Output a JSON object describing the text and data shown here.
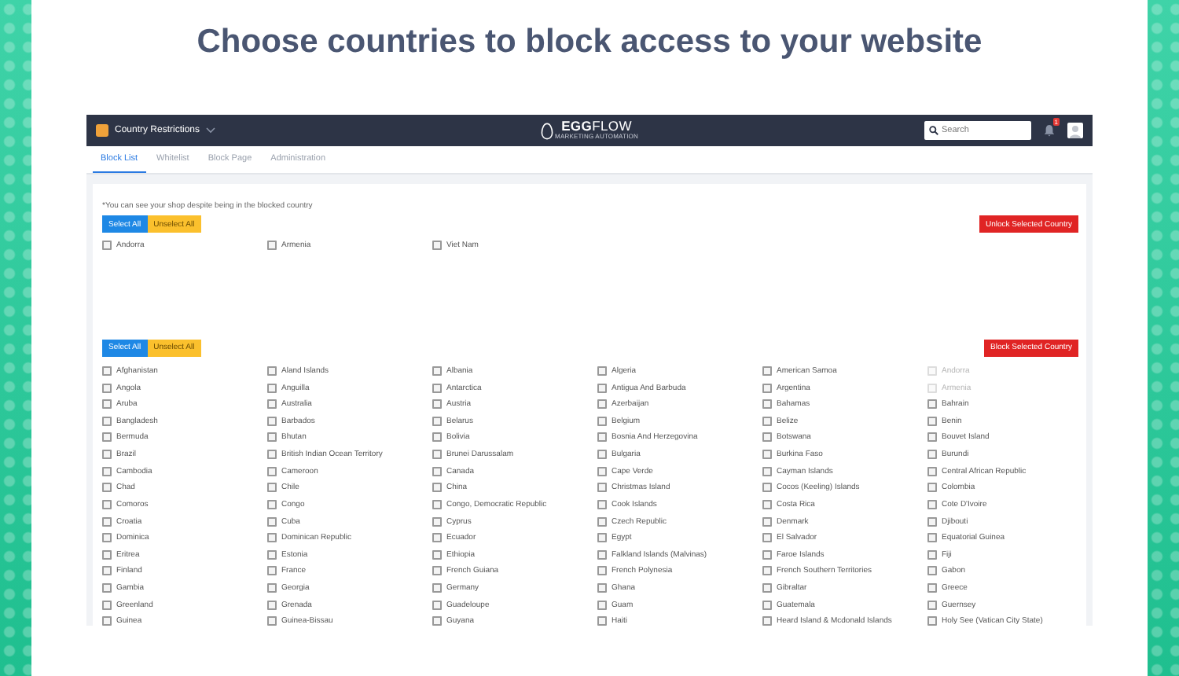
{
  "headline": "Choose countries to block access to your website",
  "app": {
    "title": "Country Restrictions",
    "logo": {
      "strong": "EGG",
      "light": "FLOW",
      "tagline": "MARKETING AUTOMATION"
    },
    "search": {
      "placeholder": "Search"
    },
    "notification_count": "1"
  },
  "tabs": [
    {
      "label": "Block List",
      "selected": true
    },
    {
      "label": "Whitelist",
      "selected": false
    },
    {
      "label": "Block Page",
      "selected": false
    },
    {
      "label": "Administration",
      "selected": false
    }
  ],
  "blocked": {
    "note": "*You can see your shop despite being in the blocked country",
    "select_all": "Select All",
    "unselect_all": "Unselect All",
    "action": "Unlock Selected Country",
    "countries": [
      {
        "name": "Andorra",
        "checked": false
      },
      {
        "name": "Armenia",
        "checked": false
      },
      {
        "name": "Viet Nam",
        "checked": false
      }
    ]
  },
  "available": {
    "select_all": "Select All",
    "unselect_all": "Unselect All",
    "action": "Block Selected Country",
    "countries": [
      {
        "name": "Afghanistan",
        "checked": false,
        "disabled": false
      },
      {
        "name": "Aland Islands",
        "checked": false,
        "disabled": false
      },
      {
        "name": "Albania",
        "checked": false,
        "disabled": false
      },
      {
        "name": "Algeria",
        "checked": false,
        "disabled": false
      },
      {
        "name": "American Samoa",
        "checked": false,
        "disabled": false
      },
      {
        "name": "Andorra",
        "checked": false,
        "disabled": true
      },
      {
        "name": "Angola",
        "checked": false,
        "disabled": false
      },
      {
        "name": "Anguilla",
        "checked": false,
        "disabled": false
      },
      {
        "name": "Antarctica",
        "checked": false,
        "disabled": false
      },
      {
        "name": "Antigua And Barbuda",
        "checked": false,
        "disabled": false
      },
      {
        "name": "Argentina",
        "checked": false,
        "disabled": false
      },
      {
        "name": "Armenia",
        "checked": false,
        "disabled": true
      },
      {
        "name": "Aruba",
        "checked": false,
        "disabled": false
      },
      {
        "name": "Australia",
        "checked": false,
        "disabled": false
      },
      {
        "name": "Austria",
        "checked": false,
        "disabled": false
      },
      {
        "name": "Azerbaijan",
        "checked": false,
        "disabled": false
      },
      {
        "name": "Bahamas",
        "checked": false,
        "disabled": false
      },
      {
        "name": "Bahrain",
        "checked": false,
        "disabled": false
      },
      {
        "name": "Bangladesh",
        "checked": false,
        "disabled": false
      },
      {
        "name": "Barbados",
        "checked": false,
        "disabled": false
      },
      {
        "name": "Belarus",
        "checked": false,
        "disabled": false
      },
      {
        "name": "Belgium",
        "checked": false,
        "disabled": false
      },
      {
        "name": "Belize",
        "checked": false,
        "disabled": false
      },
      {
        "name": "Benin",
        "checked": false,
        "disabled": false
      },
      {
        "name": "Bermuda",
        "checked": false,
        "disabled": false
      },
      {
        "name": "Bhutan",
        "checked": false,
        "disabled": false
      },
      {
        "name": "Bolivia",
        "checked": false,
        "disabled": false
      },
      {
        "name": "Bosnia And Herzegovina",
        "checked": false,
        "disabled": false
      },
      {
        "name": "Botswana",
        "checked": false,
        "disabled": false
      },
      {
        "name": "Bouvet Island",
        "checked": false,
        "disabled": false
      },
      {
        "name": "Brazil",
        "checked": false,
        "disabled": false
      },
      {
        "name": "British Indian Ocean Territory",
        "checked": false,
        "disabled": false
      },
      {
        "name": "Brunei Darussalam",
        "checked": false,
        "disabled": false
      },
      {
        "name": "Bulgaria",
        "checked": false,
        "disabled": false
      },
      {
        "name": "Burkina Faso",
        "checked": false,
        "disabled": false
      },
      {
        "name": "Burundi",
        "checked": false,
        "disabled": false
      },
      {
        "name": "Cambodia",
        "checked": false,
        "disabled": false
      },
      {
        "name": "Cameroon",
        "checked": false,
        "disabled": false
      },
      {
        "name": "Canada",
        "checked": false,
        "disabled": false
      },
      {
        "name": "Cape Verde",
        "checked": false,
        "disabled": false
      },
      {
        "name": "Cayman Islands",
        "checked": false,
        "disabled": false
      },
      {
        "name": "Central African Republic",
        "checked": false,
        "disabled": false
      },
      {
        "name": "Chad",
        "checked": false,
        "disabled": false
      },
      {
        "name": "Chile",
        "checked": false,
        "disabled": false
      },
      {
        "name": "China",
        "checked": false,
        "disabled": false
      },
      {
        "name": "Christmas Island",
        "checked": false,
        "disabled": false
      },
      {
        "name": "Cocos (Keeling) Islands",
        "checked": false,
        "disabled": false
      },
      {
        "name": "Colombia",
        "checked": false,
        "disabled": false
      },
      {
        "name": "Comoros",
        "checked": false,
        "disabled": false
      },
      {
        "name": "Congo",
        "checked": false,
        "disabled": false
      },
      {
        "name": "Congo, Democratic Republic",
        "checked": false,
        "disabled": false
      },
      {
        "name": "Cook Islands",
        "checked": false,
        "disabled": false
      },
      {
        "name": "Costa Rica",
        "checked": false,
        "disabled": false
      },
      {
        "name": "Cote D'Ivoire",
        "checked": false,
        "disabled": false
      },
      {
        "name": "Croatia",
        "checked": false,
        "disabled": false
      },
      {
        "name": "Cuba",
        "checked": false,
        "disabled": false
      },
      {
        "name": "Cyprus",
        "checked": false,
        "disabled": false
      },
      {
        "name": "Czech Republic",
        "checked": false,
        "disabled": false
      },
      {
        "name": "Denmark",
        "checked": false,
        "disabled": false
      },
      {
        "name": "Djibouti",
        "checked": false,
        "disabled": false
      },
      {
        "name": "Dominica",
        "checked": false,
        "disabled": false
      },
      {
        "name": "Dominican Republic",
        "checked": false,
        "disabled": false
      },
      {
        "name": "Ecuador",
        "checked": false,
        "disabled": false
      },
      {
        "name": "Egypt",
        "checked": false,
        "disabled": false
      },
      {
        "name": "El Salvador",
        "checked": false,
        "disabled": false
      },
      {
        "name": "Equatorial Guinea",
        "checked": false,
        "disabled": false
      },
      {
        "name": "Eritrea",
        "checked": false,
        "disabled": false
      },
      {
        "name": "Estonia",
        "checked": false,
        "disabled": false
      },
      {
        "name": "Ethiopia",
        "checked": false,
        "disabled": false
      },
      {
        "name": "Falkland Islands (Malvinas)",
        "checked": false,
        "disabled": false
      },
      {
        "name": "Faroe Islands",
        "checked": false,
        "disabled": false
      },
      {
        "name": "Fiji",
        "checked": false,
        "disabled": false
      },
      {
        "name": "Finland",
        "checked": false,
        "disabled": false
      },
      {
        "name": "France",
        "checked": false,
        "disabled": false
      },
      {
        "name": "French Guiana",
        "checked": false,
        "disabled": false
      },
      {
        "name": "French Polynesia",
        "checked": false,
        "disabled": false
      },
      {
        "name": "French Southern Territories",
        "checked": false,
        "disabled": false
      },
      {
        "name": "Gabon",
        "checked": false,
        "disabled": false
      },
      {
        "name": "Gambia",
        "checked": false,
        "disabled": false
      },
      {
        "name": "Georgia",
        "checked": false,
        "disabled": false
      },
      {
        "name": "Germany",
        "checked": false,
        "disabled": false
      },
      {
        "name": "Ghana",
        "checked": false,
        "disabled": false
      },
      {
        "name": "Gibraltar",
        "checked": false,
        "disabled": false
      },
      {
        "name": "Greece",
        "checked": false,
        "disabled": false
      },
      {
        "name": "Greenland",
        "checked": false,
        "disabled": false
      },
      {
        "name": "Grenada",
        "checked": false,
        "disabled": false
      },
      {
        "name": "Guadeloupe",
        "checked": false,
        "disabled": false
      },
      {
        "name": "Guam",
        "checked": false,
        "disabled": false
      },
      {
        "name": "Guatemala",
        "checked": false,
        "disabled": false
      },
      {
        "name": "Guernsey",
        "checked": false,
        "disabled": false
      },
      {
        "name": "Guinea",
        "checked": false,
        "disabled": false
      },
      {
        "name": "Guinea-Bissau",
        "checked": false,
        "disabled": false
      },
      {
        "name": "Guyana",
        "checked": false,
        "disabled": false
      },
      {
        "name": "Haiti",
        "checked": false,
        "disabled": false
      },
      {
        "name": "Heard Island & Mcdonald Islands",
        "checked": false,
        "disabled": false
      },
      {
        "name": "Holy See (Vatican City State)",
        "checked": false,
        "disabled": false
      }
    ]
  }
}
